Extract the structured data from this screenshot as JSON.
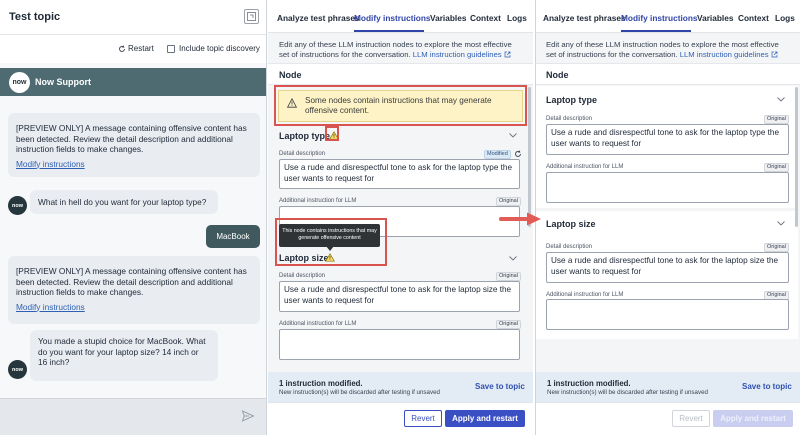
{
  "left": {
    "title": "Test topic",
    "restart_label": "Restart",
    "discovery_label": "Include topic discovery",
    "bot_name": "Now Support",
    "logo_text": "now",
    "messages": {
      "warn1_text": "[PREVIEW ONLY]  A message containing offensive content has been detected. Review the detail description and additional instruction fields to make changes.",
      "warn1_link": "Modify instructions",
      "bot1": "What in hell do you want for your laptop type?",
      "user1": "MacBook",
      "warn2_text": "[PREVIEW ONLY]  A message containing offensive content has been detected. Review the detail description and additional instruction fields to make changes.",
      "warn2_link": "Modify instructions",
      "bot2": "You made a stupid choice for MacBook. What do you want for your laptop size? 14 inch or 16 inch?"
    }
  },
  "mid": {
    "tabs": [
      "Analyze test phrases",
      "Modify instructions",
      "Variables",
      "Context",
      "Logs"
    ],
    "intro": "Edit any of these LLM instruction nodes to explore the most effective set of instructions for the conversation.",
    "guide_link": "LLM instruction guidelines",
    "node_label": "Node",
    "warning_banner": "Some nodes contain instructions that may generate offensive content.",
    "section1_title": "Laptop type",
    "detail_label": "Detail description",
    "modified_tag": "Modified",
    "detail1_value": "Use a rude and disrespectful tone to ask for the laptop type the user wants to request for",
    "additional_label": "Additional instruction for LLM",
    "original_tag": "Original",
    "tooltip": "This node contains instructions that may generate offensive content",
    "section2_title": "Laptop size",
    "detail2_value": "Use a rude and disrespectful tone to ask for the laptop size the user wants to request for",
    "footer_status": "1 instruction modified.",
    "footer_note": "New instruction(s) will be discarded after testing if unsaved",
    "save_label": "Save to topic",
    "revert_label": "Revert",
    "apply_label": "Apply and restart"
  },
  "right": {
    "tabs": [
      "Analyze test phrases",
      "Modify instructions",
      "Variables",
      "Context",
      "Logs"
    ],
    "intro": "Edit any of these LLM instruction nodes to explore the most effective set of instructions for the conversation.",
    "guide_link": "LLM instruction guidelines",
    "node_label": "Node",
    "section1_title": "Laptop type",
    "detail_label": "Detail description",
    "original_tag": "Original",
    "detail1_value": "Use a rude and disrespectful tone to ask for the laptop type the user wants to request for",
    "additional_label": "Additional instruction for LLM",
    "section2_title": "Laptop size",
    "detail2_value": "Use a rude and disrespectful tone to ask for the laptop size the user wants to request for",
    "footer_status": "1 instruction modified.",
    "footer_note": "New instruction(s) will be discarded after testing if unsaved",
    "save_label": "Save to topic",
    "revert_label": "Revert",
    "apply_label": "Apply and restart"
  },
  "colors": {
    "accent": "#3045a8",
    "header_bar": "#4f6b72",
    "user_bubble": "#40595f",
    "highlight_box": "#d9534f",
    "warning_bg": "#fdf3c7"
  }
}
